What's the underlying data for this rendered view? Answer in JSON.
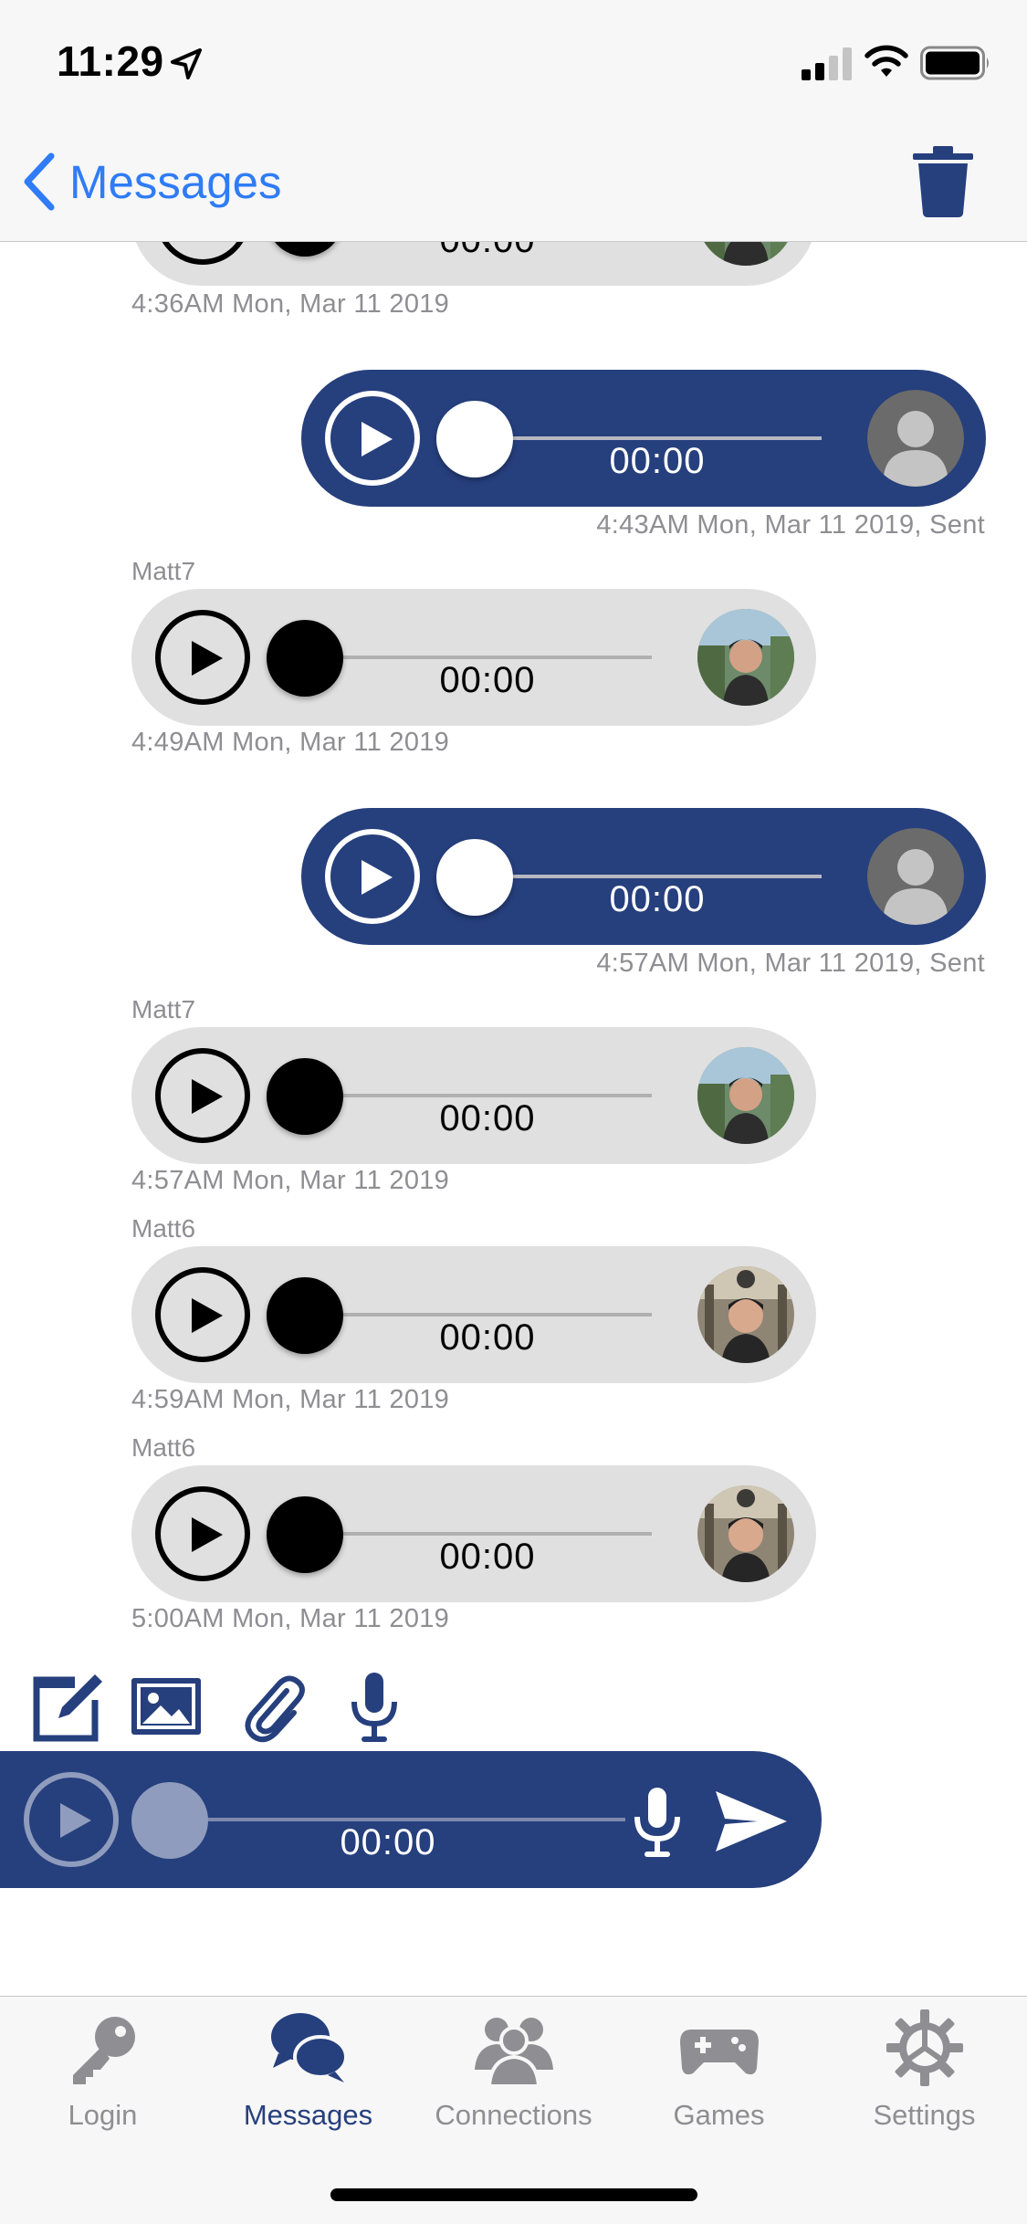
{
  "status_bar": {
    "time": "11:29"
  },
  "nav": {
    "back_label": "Messages"
  },
  "messages": [
    {
      "direction": "in",
      "sender": "",
      "duration": "00:00",
      "timestamp": "4:36AM Mon, Mar 11 2019",
      "avatar": "photo-man-waterfall"
    },
    {
      "direction": "out",
      "sender": "",
      "duration": "00:00",
      "timestamp": "4:43AM Mon, Mar 11 2019, Sent",
      "avatar": "default-user"
    },
    {
      "direction": "in",
      "sender": "Matt7",
      "duration": "00:00",
      "timestamp": "4:49AM Mon, Mar 11 2019",
      "avatar": "photo-man-waterfall"
    },
    {
      "direction": "out",
      "sender": "",
      "duration": "00:00",
      "timestamp": "4:57AM Mon, Mar 11 2019, Sent",
      "avatar": "default-user"
    },
    {
      "direction": "in",
      "sender": "Matt7",
      "duration": "00:00",
      "timestamp": "4:57AM Mon, Mar 11 2019",
      "avatar": "photo-man-waterfall"
    },
    {
      "direction": "in",
      "sender": "Matt6",
      "duration": "00:00",
      "timestamp": "4:59AM Mon, Mar 11 2019",
      "avatar": "photo-man-station"
    },
    {
      "direction": "in",
      "sender": "Matt6",
      "duration": "00:00",
      "timestamp": "5:00AM Mon, Mar 11 2019",
      "avatar": "photo-man-station"
    }
  ],
  "composer": {
    "tools": [
      "compose-icon",
      "image-icon",
      "paperclip-icon",
      "microphone-icon"
    ],
    "duration": "00:00"
  },
  "tabs": [
    {
      "label": "Login",
      "icon": "key-icon",
      "active": false
    },
    {
      "label": "Messages",
      "icon": "chat-bubbles-icon",
      "active": true
    },
    {
      "label": "Connections",
      "icon": "people-icon",
      "active": false
    },
    {
      "label": "Games",
      "icon": "gamepad-icon",
      "active": false
    },
    {
      "label": "Settings",
      "icon": "gear-icon",
      "active": false
    }
  ],
  "colors": {
    "brand_navy": "#263f7d",
    "link_blue": "#2f7cf6",
    "incoming_bubble": "#e0e0e0",
    "meta_gray": "#8e8e93"
  }
}
